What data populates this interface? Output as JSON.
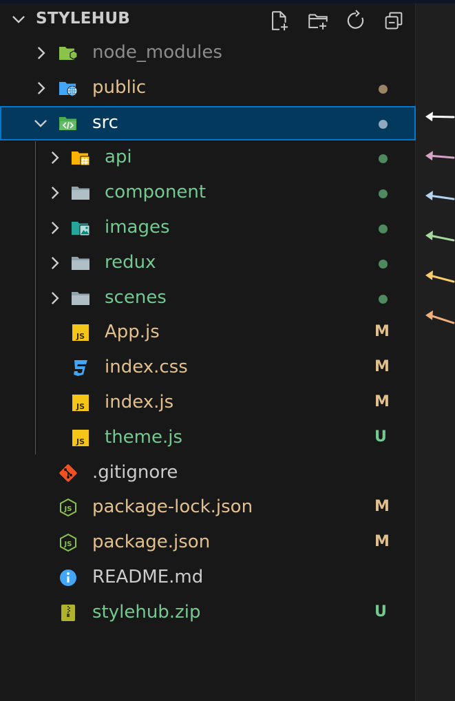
{
  "explorer": {
    "root_name": "STYLEHUB",
    "header_actions": [
      {
        "name": "new-file-icon",
        "tooltip": "New File"
      },
      {
        "name": "new-folder-icon",
        "tooltip": "New Folder"
      },
      {
        "name": "refresh-icon",
        "tooltip": "Refresh Explorer"
      },
      {
        "name": "collapse-all-icon",
        "tooltip": "Collapse Folders"
      }
    ],
    "tree": [
      {
        "label": "node_modules",
        "type": "folder",
        "expanded": false,
        "depth": 1,
        "icon": "node-folder-icon",
        "label_color": "#8c8c8c",
        "status_dot": null
      },
      {
        "label": "public",
        "type": "folder",
        "expanded": false,
        "depth": 1,
        "icon": "public-folder-icon",
        "label_color": "#e2c08d",
        "status_dot": "#9a8466"
      },
      {
        "label": "src",
        "type": "folder",
        "expanded": true,
        "depth": 1,
        "icon": "src-folder-icon",
        "label_color": "#ffffff",
        "status_dot": "#8fa9c0",
        "selected": true
      },
      {
        "label": "api",
        "type": "folder",
        "expanded": false,
        "depth": 2,
        "icon": "api-folder-icon",
        "label_color": "#73c991",
        "status_dot": "#4e8a5e"
      },
      {
        "label": "component",
        "type": "folder",
        "expanded": false,
        "depth": 2,
        "icon": "folder-icon",
        "label_color": "#73c991",
        "status_dot": "#4e8a5e"
      },
      {
        "label": "images",
        "type": "folder",
        "expanded": false,
        "depth": 2,
        "icon": "images-folder-icon",
        "label_color": "#73c991",
        "status_dot": "#4e8a5e"
      },
      {
        "label": "redux",
        "type": "folder",
        "expanded": false,
        "depth": 2,
        "icon": "folder-icon",
        "label_color": "#73c991",
        "status_dot": "#4e8a5e"
      },
      {
        "label": "scenes",
        "type": "folder",
        "expanded": false,
        "depth": 2,
        "icon": "folder-icon",
        "label_color": "#73c991",
        "status_dot": "#4e8a5e"
      },
      {
        "label": "App.js",
        "type": "file",
        "depth": 2,
        "icon": "js-file-icon",
        "label_color": "#e2c08d",
        "git_status": "M",
        "git_color": "#e2c08d"
      },
      {
        "label": "index.css",
        "type": "file",
        "depth": 2,
        "icon": "css-file-icon",
        "label_color": "#e2c08d",
        "git_status": "M",
        "git_color": "#e2c08d"
      },
      {
        "label": "index.js",
        "type": "file",
        "depth": 2,
        "icon": "js-file-icon",
        "label_color": "#e2c08d",
        "git_status": "M",
        "git_color": "#e2c08d"
      },
      {
        "label": "theme.js",
        "type": "file",
        "depth": 2,
        "icon": "js-file-icon",
        "label_color": "#73c991",
        "git_status": "U",
        "git_color": "#73c991"
      },
      {
        "label": ".gitignore",
        "type": "file",
        "depth": 1,
        "icon": "git-file-icon",
        "label_color": "#cccccc",
        "git_status": ""
      },
      {
        "label": "package-lock.json",
        "type": "file",
        "depth": 1,
        "icon": "node-json-icon",
        "label_color": "#e2c08d",
        "git_status": "M",
        "git_color": "#e2c08d"
      },
      {
        "label": "package.json",
        "type": "file",
        "depth": 1,
        "icon": "node-json-icon",
        "label_color": "#e2c08d",
        "git_status": "M",
        "git_color": "#e2c08d"
      },
      {
        "label": "README.md",
        "type": "file",
        "depth": 1,
        "icon": "info-icon",
        "label_color": "#cccccc",
        "git_status": ""
      },
      {
        "label": "stylehub.zip",
        "type": "file",
        "depth": 1,
        "icon": "zip-file-icon",
        "label_color": "#73c991",
        "git_status": "U",
        "git_color": "#73c991"
      }
    ]
  },
  "annotation_arrows": [
    {
      "target": "src",
      "color": "#ffffff"
    },
    {
      "target": "api",
      "color": "#d7a3c9"
    },
    {
      "target": "component",
      "color": "#b3d4f0"
    },
    {
      "target": "images",
      "color": "#a8d8a0"
    },
    {
      "target": "redux",
      "color": "#f8cc6a"
    },
    {
      "target": "scenes",
      "color": "#f0b07a"
    }
  ]
}
